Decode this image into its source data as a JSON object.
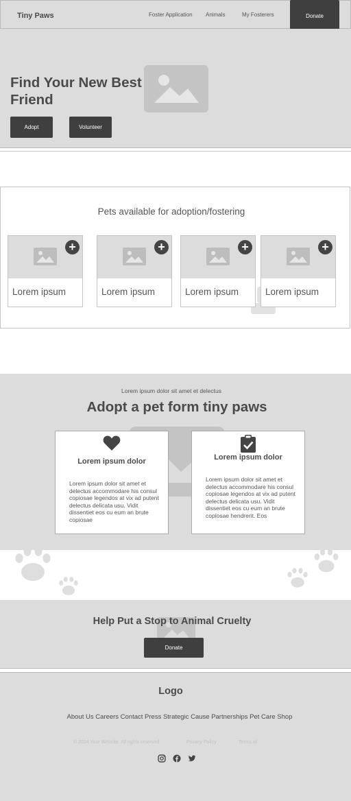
{
  "header": {
    "brand": "Tiny Paws",
    "nav": [
      "Foster Application",
      "Animals",
      "My Fosterers"
    ],
    "donate_label": "Donate"
  },
  "hero": {
    "title": "Find Your New Best Friend",
    "adopt_label": "Adopt",
    "volunteer_label": "Volunteer",
    "image_icon": "image-placeholder-icon"
  },
  "pets": {
    "title": "Pets available for adoption/fostering",
    "cards": [
      {
        "label": "Lorem ipsum",
        "icon": "plus-circle-icon"
      },
      {
        "label": "Lorem ipsum",
        "icon": "plus-circle-icon"
      },
      {
        "label": "Lorem ipsum",
        "icon": "plus-circle-icon"
      },
      {
        "label": "Lorem ipsum",
        "icon": "plus-circle-icon"
      }
    ]
  },
  "adopt": {
    "kicker": "Lorem ipsum dolor sit amet et delectus",
    "title": "Adopt a pet form tiny paws",
    "features": [
      {
        "icon": "heart-icon",
        "title": "Lorem ipsum dolor",
        "body": "Lorem ipsum dolor sit amet et delectus accommodare his consul copiosae legendos at vix ad putent delectus delicata usu. Vidit dissentiet eos cu eum an brute copiosae"
      },
      {
        "icon": "clipboard-check-icon",
        "title": "Lorem ipsum dolor",
        "body": "Lorem ipsum dolor sit amet et delectus accommodare his consul copiosae legendos at vix ad putent delectus delicata usu. Vidit dissentiet eos cu eum an brute copiosae hendrerit. Eos"
      }
    ]
  },
  "cruelty": {
    "title": "Help Put a Stop to Animal Cruelty",
    "donate_label": "Donate"
  },
  "footer": {
    "logo": "Logo",
    "links": "About Us Careers Contact Press Strategic Cause Partnerships Pet Care Shop",
    "copyright": "© 2024 Your Website. All rights reserved.",
    "privacy": "Privacy Policy",
    "terms": "Terms of",
    "social": [
      "instagram-icon",
      "facebook-icon",
      "twitter-icon"
    ]
  },
  "colors": {
    "background_gray": "#dcdcdc",
    "button_dark": "#3f3f3f",
    "placeholder_icon": "#bdbdbd"
  }
}
